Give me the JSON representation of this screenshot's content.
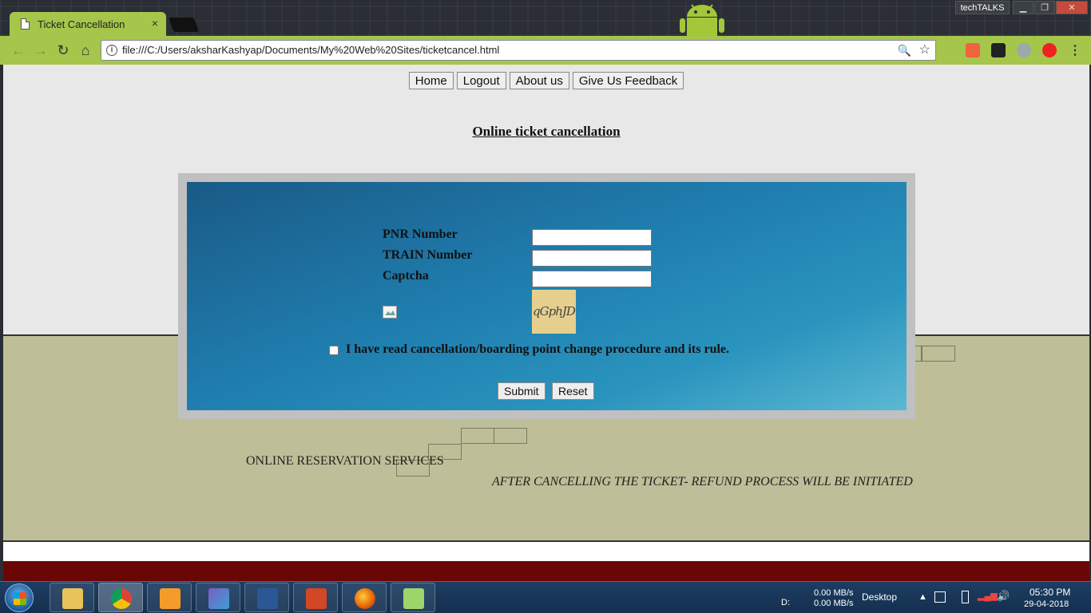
{
  "browser": {
    "tab_title": "Ticket Cancellation",
    "tab_close": "×",
    "url": "file:///C:/Users/aksharKashyap/Documents/My%20Web%20Sites/ticketcancel.html",
    "profile_label": "techTALKS",
    "window_minimize": "▁",
    "window_restore": "❐",
    "window_close": "✕",
    "back_icon": "←",
    "forward_icon": "→",
    "reload_icon": "↻",
    "home_icon": "⌂",
    "zoom_icon": "🔍",
    "star_icon": "☆",
    "menu_icon": "⋮",
    "info_icon": "i"
  },
  "nav": {
    "home": "Home",
    "logout": "Logout",
    "about": "About us",
    "feedback": "Give Us Feedback"
  },
  "page": {
    "heading": "Online ticket cancellation"
  },
  "form": {
    "pnr_label": "PNR Number",
    "pnr_value": "",
    "train_label": "TRAIN Number",
    "train_value": "",
    "captcha_label": "Captcha",
    "captcha_value": "",
    "captcha_text": "qGphJD",
    "agree_label": "I have read cancellation/boarding point change procedure and its rule.",
    "agree_checked": false,
    "submit_label": "Submit",
    "reset_label": "Reset"
  },
  "footer": {
    "services": "ONLINE RESERVATION SERVICES",
    "refund_note": "AFTER CANCELLING THE TICKET- REFUND PROCESS WILL BE INITIATED"
  },
  "taskbar": {
    "drive": "D:",
    "net_up": "0.00 MB/s",
    "net_down": "0.00 MB/s",
    "desktop": "Desktop",
    "time": "05:30 PM",
    "date": "29-04-2018"
  },
  "colors": {
    "chrome_theme": "#a5c64a",
    "form_panel": "#1f7eaf",
    "footer_band": "#bebe98",
    "bottom_bar": "#6b0606"
  }
}
